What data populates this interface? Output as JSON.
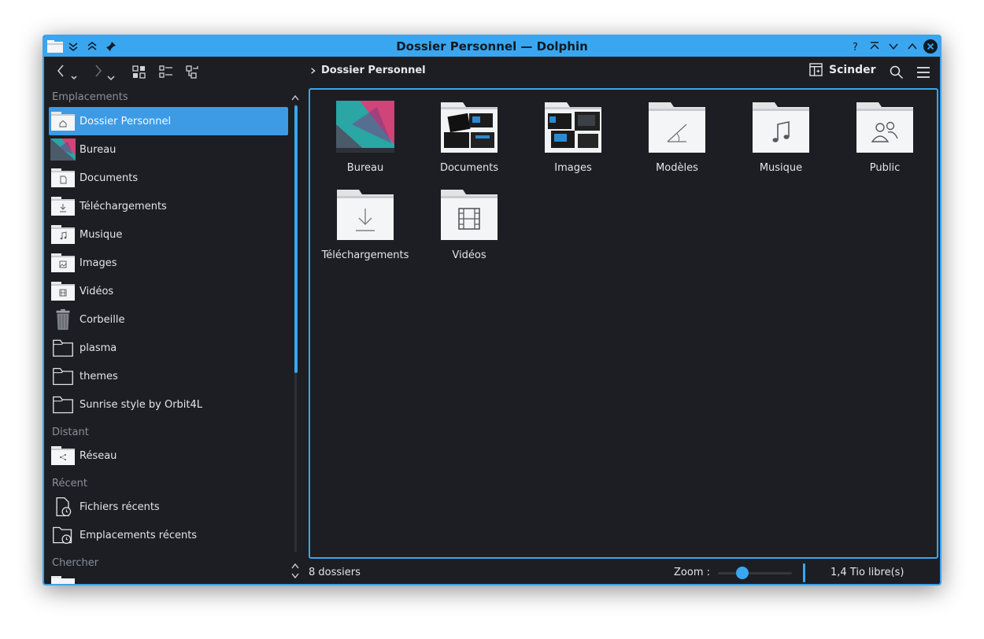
{
  "window": {
    "title": "Dossier Personnel — Dolphin"
  },
  "toolbar": {
    "breadcrumb": "Dossier Personnel",
    "split_label": "Scinder"
  },
  "sidebar": {
    "sections": {
      "places": "Emplacements",
      "remote": "Distant",
      "recent": "Récent",
      "search": "Chercher"
    },
    "places": [
      {
        "label": "Dossier Personnel",
        "icon": "home-folder-icon",
        "selected": true
      },
      {
        "label": "Bureau",
        "icon": "desktop-icon"
      },
      {
        "label": "Documents",
        "icon": "documents-folder-icon"
      },
      {
        "label": "Téléchargements",
        "icon": "downloads-folder-icon"
      },
      {
        "label": "Musique",
        "icon": "music-folder-icon"
      },
      {
        "label": "Images",
        "icon": "pictures-folder-icon"
      },
      {
        "label": "Vidéos",
        "icon": "videos-folder-icon"
      },
      {
        "label": "Corbeille",
        "icon": "trash-icon"
      },
      {
        "label": "plasma",
        "icon": "folder-icon"
      },
      {
        "label": "themes",
        "icon": "folder-icon"
      },
      {
        "label": "Sunrise style by Orbit4L",
        "icon": "folder-icon"
      }
    ],
    "remote": [
      {
        "label": "Réseau",
        "icon": "network-folder-icon"
      }
    ],
    "recent": [
      {
        "label": "Fichiers récents",
        "icon": "recent-files-icon"
      },
      {
        "label": "Emplacements récents",
        "icon": "recent-places-icon"
      }
    ]
  },
  "main": {
    "items": [
      {
        "label": "Bureau",
        "icon": "desktop-wallpaper-thumb"
      },
      {
        "label": "Documents",
        "icon": "documents-folder-preview"
      },
      {
        "label": "Images",
        "icon": "images-folder-preview"
      },
      {
        "label": "Modèles",
        "icon": "templates-folder-icon"
      },
      {
        "label": "Musique",
        "icon": "music-folder-icon"
      },
      {
        "label": "Public",
        "icon": "public-folder-icon"
      },
      {
        "label": "Téléchargements",
        "icon": "downloads-folder-icon"
      },
      {
        "label": "Vidéos",
        "icon": "videos-folder-icon"
      }
    ]
  },
  "status": {
    "count": "8 dossiers",
    "zoom_label": "Zoom :",
    "zoom_level": 0.33,
    "free_space": "1,4 Tio libre(s)"
  },
  "colors": {
    "accent": "#3aa6f0",
    "background": "#1d1e23",
    "text": "#e3e5e8"
  }
}
